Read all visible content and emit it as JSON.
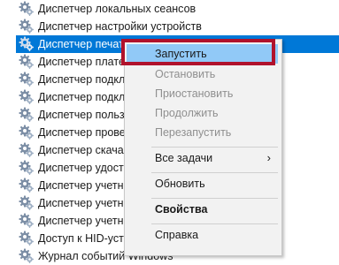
{
  "services": [
    {
      "name": "Диспетчер локальных сеансов"
    },
    {
      "name": "Диспетчер настройки устройств"
    },
    {
      "name": "Диспетчер печати"
    },
    {
      "name": "Диспетчер плате"
    },
    {
      "name": "Диспетчер подкл"
    },
    {
      "name": "Диспетчер подкл"
    },
    {
      "name": "Диспетчер польз"
    },
    {
      "name": "Диспетчер провер"
    },
    {
      "name": "Диспетчер скачан"
    },
    {
      "name": "Диспетчер удосто"
    },
    {
      "name": "Диспетчер учетнь"
    },
    {
      "name": "Диспетчер учетнь"
    },
    {
      "name": "Диспетчер учетнь"
    },
    {
      "name": "Доступ к HID-устр"
    },
    {
      "name": "Журнал событий Windows"
    }
  ],
  "context_menu": {
    "items": [
      {
        "label": "Запустить",
        "state": "enabled",
        "highlighted": true
      },
      {
        "label": "Остановить",
        "state": "disabled"
      },
      {
        "label": "Приостановить",
        "state": "disabled"
      },
      {
        "label": "Продолжить",
        "state": "disabled"
      },
      {
        "label": "Перезапустить",
        "state": "disabled"
      },
      {
        "label": "Все задачи",
        "state": "enabled",
        "submenu_arrow": "›"
      },
      {
        "label": "Обновить",
        "state": "enabled"
      },
      {
        "label": "Свойства",
        "state": "enabled",
        "bold": true
      },
      {
        "label": "Справка",
        "state": "enabled"
      }
    ]
  },
  "colors": {
    "selection": "#0078d7",
    "menu_highlight": "#91c9f7",
    "annotation_frame": "#b0122c"
  },
  "icons": {
    "service": "gear-icon"
  }
}
